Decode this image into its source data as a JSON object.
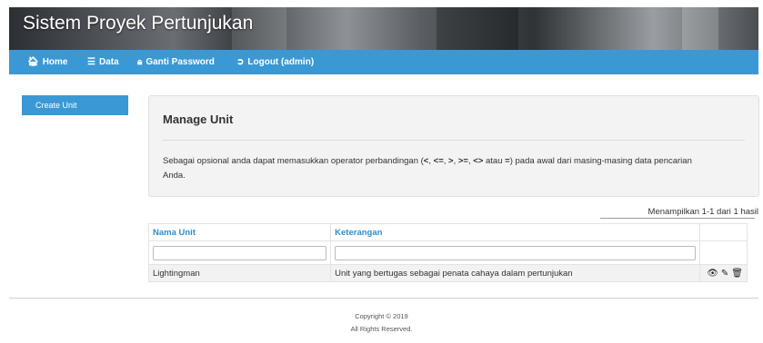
{
  "header": {
    "title": "Sistem Proyek Pertunjukan"
  },
  "nav": {
    "home": "Home",
    "data": "Data",
    "password": "Ganti Password",
    "logout": "Logout (admin)"
  },
  "sidebar": {
    "create": "Create Unit"
  },
  "panel": {
    "title": "Manage Unit",
    "desc_a": "Sebagai opsional anda dapat memasukkan operator perbandingan (",
    "op_lt": "<",
    "sep1": ", ",
    "op_le": "<=",
    "sep2": ", ",
    "op_gt": ">",
    "sep3": ", ",
    "op_ge": ">=",
    "sep4": ", ",
    "op_ne": "<>",
    "desc_b": " atau ",
    "op_eq": "=",
    "desc_c": ") pada awal dari masing-masing data pencarian Anda."
  },
  "grid": {
    "summary": "Menampilkan 1-1 dari 1 hasil",
    "columns": [
      "Nama Unit",
      "Keterangan"
    ],
    "filter_values": [
      "",
      ""
    ],
    "rows": [
      {
        "nama_unit": "Lightingman",
        "keterangan": "Unit yang bertugas sebagai penata cahaya dalam pertunjukan"
      }
    ]
  },
  "footer": {
    "copyright": "Copyright © 2019",
    "rights": "All Rights Reserved."
  },
  "colors": {
    "nav": "#3a99d4",
    "link": "#2b8fd0",
    "panel": "#f3f3f3"
  },
  "icons": [
    "home-icon",
    "list-icon",
    "lock-icon",
    "sign-out-icon",
    "eye-icon",
    "pencil-icon",
    "trash-icon"
  ]
}
